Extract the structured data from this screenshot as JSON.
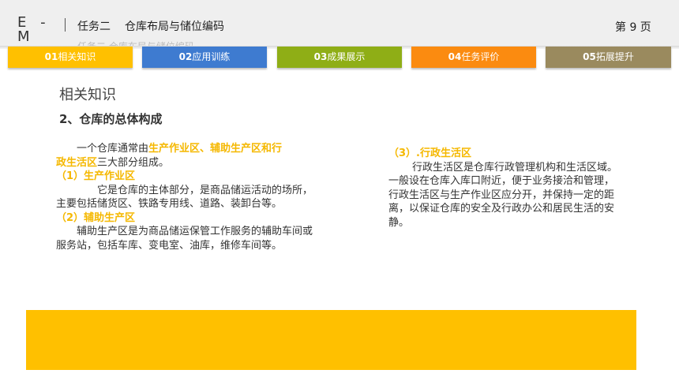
{
  "header": {
    "logo_text": "E - M",
    "task": "任务二",
    "topic": "仓库布局与储位编码",
    "ghost_text": "任务二 仓库布局与储位编码",
    "page": "第 9 页"
  },
  "tabs": [
    {
      "num": "01",
      "label": "相关知识",
      "color": "#ffc000"
    },
    {
      "num": "02",
      "label": "应用训练",
      "color": "#3e7bd0"
    },
    {
      "num": "03",
      "label": "成果展示",
      "color": "#8fae16"
    },
    {
      "num": "04",
      "label": "任务评价",
      "color": "#fb8b10"
    },
    {
      "num": "05",
      "label": "拓展提升",
      "color": "#9a8a5e"
    }
  ],
  "content": {
    "section_title": "相关知识",
    "sub_title": "2、仓库的总体构成",
    "intro_prefix": "一个仓库通常由",
    "intro_highlight_1": "生产作业区、辅助生产区和行",
    "intro_highlight_2": "政生活区",
    "intro_suffix": "三大部分组成。",
    "item1_title": "（1）生产作业区",
    "item1_text": "它是仓库的主体部分，是商品储运活动的场所，主要包括储货区、铁路专用线、道路、装卸台等。",
    "item2_title": "（2）辅助生产区",
    "item2_text": "辅助生产区是为商品储运保管工作服务的辅助车间或服务站，包括车库、变电室、油库，维修车间等。",
    "item3_title": "（3）.行政生活区",
    "item3_text": "行政生活区是仓库行政管理机构和生活区域。一般设在仓库入库口附近，便于业务接洽和管理，行政生活区与生产作业区应分开，并保持一定的距离，以保证仓库的安全及行政办公和居民生活的安静。"
  },
  "colors": {
    "highlight": "#f5b800",
    "bottom_box": "#ffc000"
  }
}
